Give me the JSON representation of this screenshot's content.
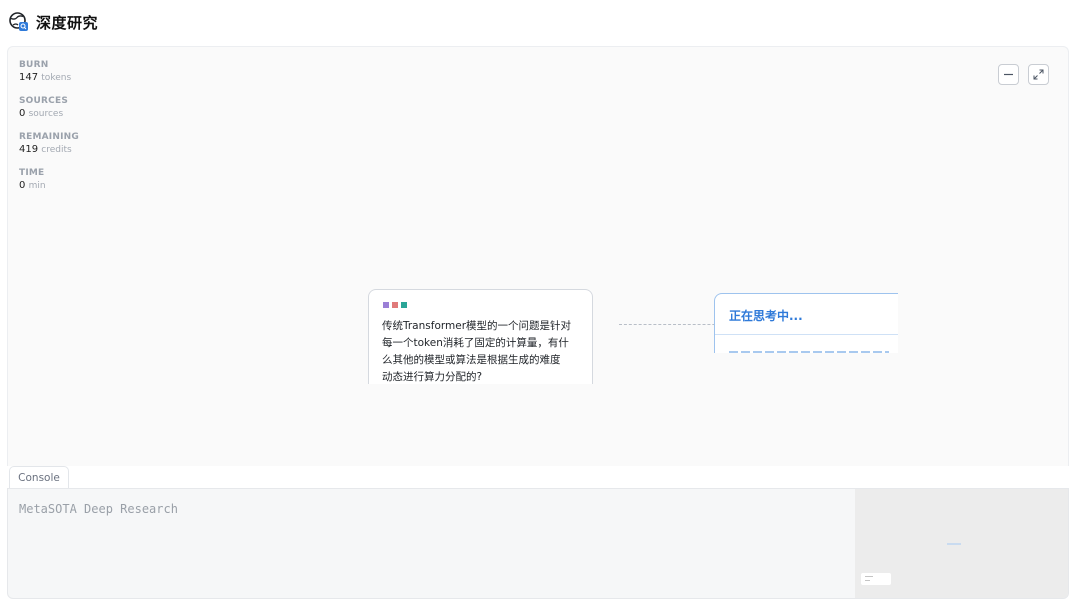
{
  "header": {
    "title": "深度研究",
    "logo_icon": "globe-search-icon"
  },
  "stats": [
    {
      "label": "BURN",
      "value": "147",
      "unit": "tokens"
    },
    {
      "label": "SOURCES",
      "value": "0",
      "unit": "sources"
    },
    {
      "label": "REMAINING",
      "value": "419",
      "unit": "credits"
    },
    {
      "label": "TIME",
      "value": "0",
      "unit": "min"
    }
  ],
  "controls": {
    "minimize_icon": "minimize-icon",
    "expand_icon": "expand-icon"
  },
  "query_node": {
    "dot_colors": [
      "#9b7fd6",
      "#e07a7a",
      "#2aa597"
    ],
    "lines": [
      "传统Transformer模型的一个问题是针对",
      "每一个token消耗了固定的计算量，有什",
      "么其他的模型或算法是根据生成的难度",
      "动态进行算力分配的?"
    ]
  },
  "think_node": {
    "title": "正在思考中..."
  },
  "console": {
    "tab_label": "Console",
    "text": "MetaSOTA Deep Research"
  },
  "colors": {
    "accent": "#2f7ad9"
  }
}
